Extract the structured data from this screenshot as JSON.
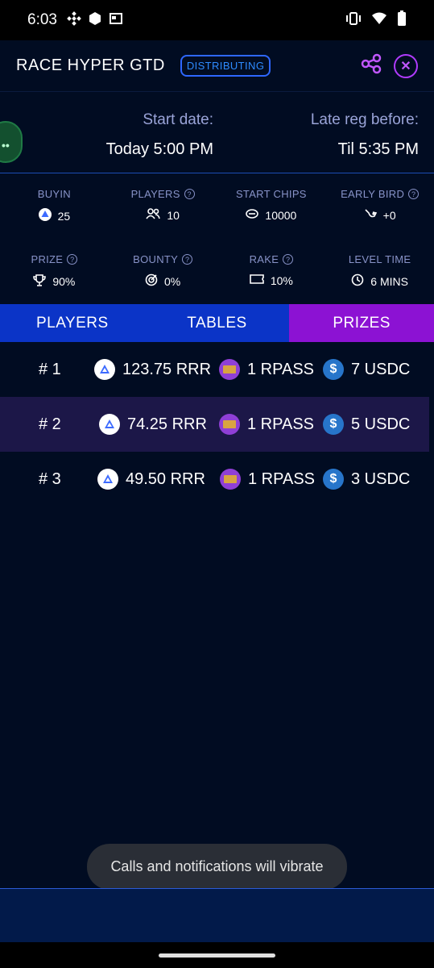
{
  "status_bar": {
    "time": "6:03"
  },
  "header": {
    "title": "RACE HYPER GTD",
    "badge": "DISTRIBUTING"
  },
  "dates": {
    "start_label": "Start date:",
    "start_value": "Today 5:00 PM",
    "latereg_label": "Late reg before:",
    "latereg_value": "Til 5:35 PM"
  },
  "stats": {
    "buyin": {
      "label": "BUYIN",
      "value": "25"
    },
    "players": {
      "label": "PLAYERS",
      "value": "10"
    },
    "start_chips": {
      "label": "START CHIPS",
      "value": "10000"
    },
    "early_bird": {
      "label": "EARLY BIRD",
      "value": "+0"
    },
    "prize": {
      "label": "PRIZE",
      "value": "90%"
    },
    "bounty": {
      "label": "BOUNTY",
      "value": "0%"
    },
    "rake": {
      "label": "RAKE",
      "value": "10%"
    },
    "level_time": {
      "label": "LEVEL TIME",
      "value": "6 MINS"
    }
  },
  "tabs": [
    {
      "label": "PLAYERS"
    },
    {
      "label": "TABLES"
    },
    {
      "label": "PRIZES"
    }
  ],
  "prizes": [
    {
      "rank": "# 1",
      "rrr": "123.75 RRR",
      "pass": "1 RPASS",
      "usdc": "7 USDC"
    },
    {
      "rank": "# 2",
      "rrr": "74.25 RRR",
      "pass": "1 RPASS",
      "usdc": "5 USDC"
    },
    {
      "rank": "# 3",
      "rrr": "49.50 RRR",
      "pass": "1 RPASS",
      "usdc": "3 USDC"
    }
  ],
  "toast": "Calls and notifications will vibrate",
  "colors": {
    "tab_bg": "#0b34c7",
    "tab_active": "#8c12d3",
    "background": "#010c22",
    "accent_purple": "#b03bff"
  }
}
